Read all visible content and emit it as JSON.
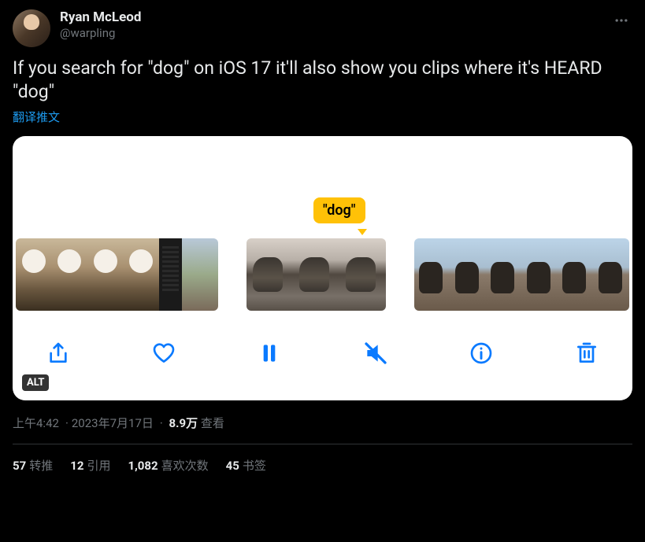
{
  "user": {
    "display_name": "Ryan McLeod",
    "handle": "@warpling"
  },
  "tweet_text": "If you search for \"dog\" on iOS 17 it'll also show you clips where it's HEARD \"dog\"",
  "translate_label": "翻译推文",
  "media": {
    "search_term": "\"dog\"",
    "alt_badge": "ALT",
    "toolbar_icons": {
      "share": "share-icon",
      "heart": "heart-icon",
      "pause": "pause-icon",
      "mute": "mute-icon",
      "info": "info-icon",
      "trash": "trash-icon"
    }
  },
  "meta": {
    "time": "上午4:42",
    "date": "2023年7月17日",
    "views_count": "8.9万",
    "views_label": "查看"
  },
  "stats": {
    "retweets_count": "57",
    "retweets_label": "转推",
    "quotes_count": "12",
    "quotes_label": "引用",
    "likes_count": "1,082",
    "likes_label": "喜欢次数",
    "bookmarks_count": "45",
    "bookmarks_label": "书签"
  }
}
